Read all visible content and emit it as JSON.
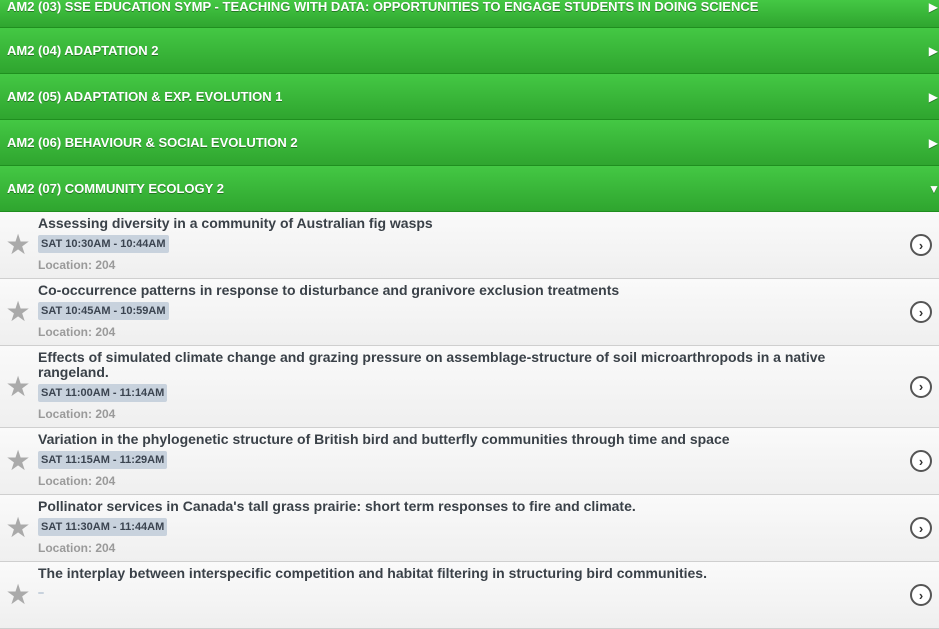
{
  "sections": [
    {
      "label": "AM2 (03) SSE EDUCATION SYMP - TEACHING WITH DATA: OPPORTUNITIES TO ENGAGE STUDENTS IN DOING SCIENCE",
      "arrow": "▶"
    },
    {
      "label": "AM2 (04) ADAPTATION 2",
      "arrow": "▶"
    },
    {
      "label": "AM2 (05) ADAPTATION & EXP. EVOLUTION 1",
      "arrow": "▶"
    },
    {
      "label": "AM2 (06) BEHAVIOUR & SOCIAL EVOLUTION 2",
      "arrow": "▶"
    },
    {
      "label": "AM2 (07) COMMUNITY ECOLOGY 2",
      "arrow": "▼"
    }
  ],
  "sessions": [
    {
      "title": "Assessing diversity in a community of Australian fig wasps",
      "time": "SAT 10:30AM - 10:44AM",
      "location": "Location: 204"
    },
    {
      "title": "Co-occurrence patterns in response to disturbance and granivore exclusion treatments",
      "time": "SAT 10:45AM - 10:59AM",
      "location": "Location: 204"
    },
    {
      "title": "Effects of simulated climate change and grazing pressure on assemblage-structure of soil microarthropods in a native rangeland.",
      "time": "SAT 11:00AM - 11:14AM",
      "location": "Location: 204"
    },
    {
      "title": "Variation in the phylogenetic structure of British bird and butterfly communities through time and space",
      "time": "SAT 11:15AM - 11:29AM",
      "location": "Location: 204"
    },
    {
      "title": "Pollinator services in Canada's tall grass prairie: short term responses to fire and climate.",
      "time": "SAT 11:30AM - 11:44AM",
      "location": "Location: 204"
    },
    {
      "title": "The interplay between interspecific competition and habitat filtering in structuring bird communities.",
      "time": "",
      "location": ""
    }
  ],
  "icons": {
    "star": "star-icon",
    "chevron": "chevron-right-circle-icon"
  },
  "colors": {
    "header_green": "#3cb83c",
    "time_badge": "#c8d2dd"
  }
}
